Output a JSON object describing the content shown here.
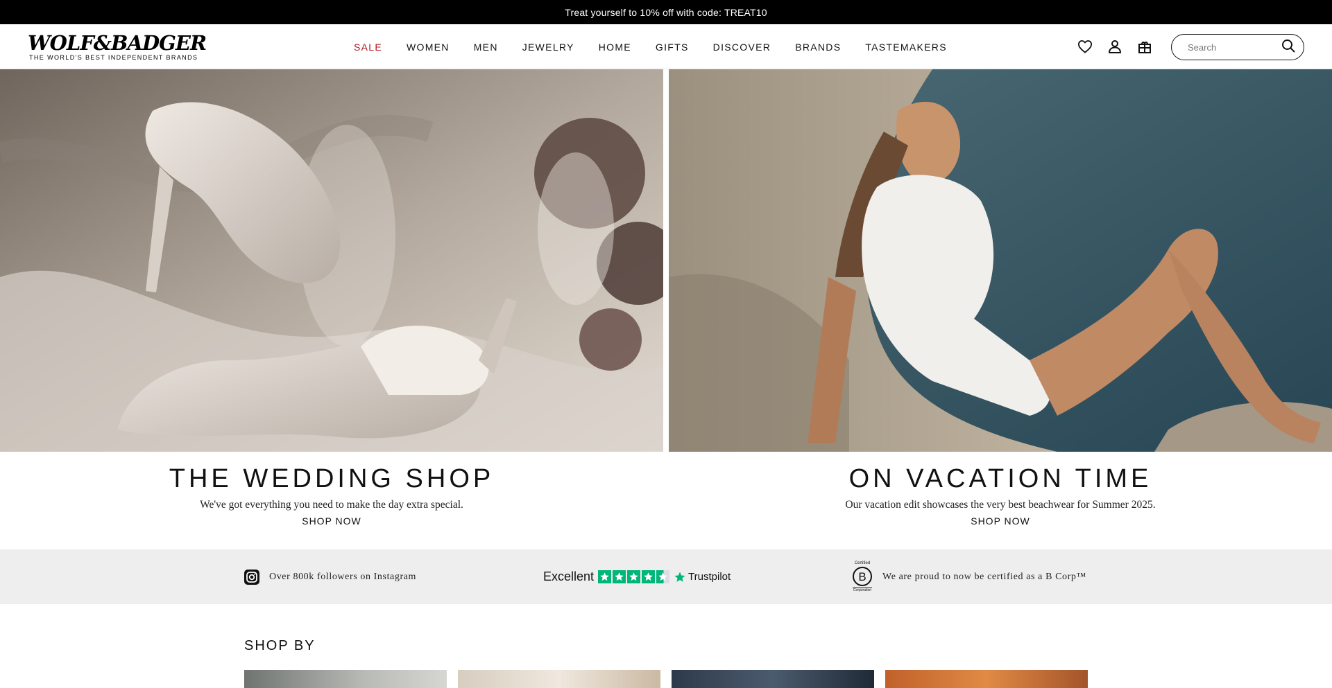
{
  "promo": {
    "text": "Treat yourself to 10% off with code: TREAT10"
  },
  "header": {
    "logo_word": "WOLF&BADGER",
    "logo_tagline": "THE WORLD'S BEST INDEPENDENT BRANDS",
    "nav": [
      {
        "label": "SALE"
      },
      {
        "label": "WOMEN"
      },
      {
        "label": "MEN"
      },
      {
        "label": "JEWELRY"
      },
      {
        "label": "HOME"
      },
      {
        "label": "GIFTS"
      },
      {
        "label": "DISCOVER"
      },
      {
        "label": "BRANDS"
      },
      {
        "label": "TASTEMAKERS"
      }
    ],
    "icons": [
      "heart-icon",
      "user-icon",
      "bag-icon"
    ],
    "search": {
      "placeholder": "Search",
      "value": ""
    }
  },
  "heroes": [
    {
      "title": "THE WEDDING SHOP",
      "subtitle": "We've got everything you need to make the day extra special.",
      "cta": "SHOP NOW"
    },
    {
      "title": "ON VACATION TIME",
      "subtitle": "Our vacation edit showcases the very best beachwear for Summer 2025.",
      "cta": "SHOP NOW"
    }
  ],
  "trust": {
    "instagram": "Over 800k followers on Instagram",
    "trustpilot_rating": "Excellent",
    "trustpilot_brand": "Trustpilot",
    "bcorp_top": "Certified",
    "bcorp_bottom": "Corporation",
    "bcorp": "We are proud to now be certified as a B Corp™"
  },
  "shop_by": {
    "title": "SHOP BY"
  },
  "colors": {
    "sale": "#b0171f",
    "trustpilot": "#00b67a",
    "strip": "#eeeeee"
  }
}
